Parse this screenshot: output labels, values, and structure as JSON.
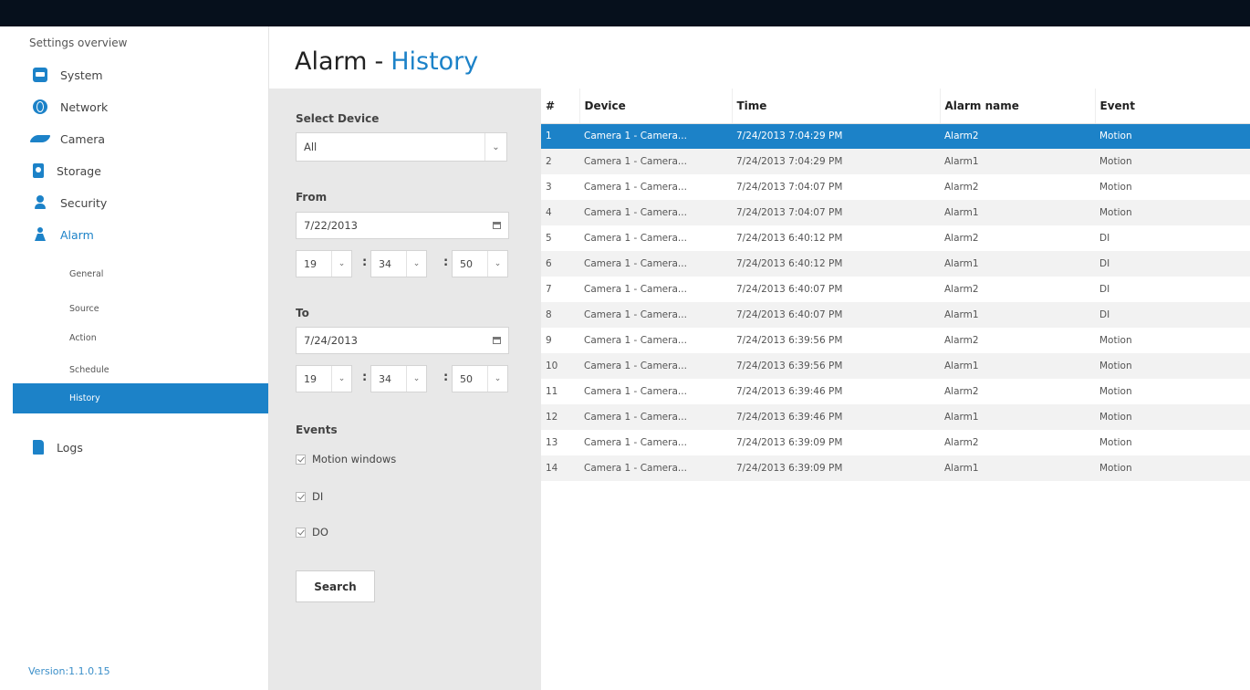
{
  "sidebar": {
    "title": "Settings overview",
    "items": [
      {
        "label": "System",
        "icon": "system-icon"
      },
      {
        "label": "Network",
        "icon": "globe-icon"
      },
      {
        "label": "Camera",
        "icon": "camera-icon"
      },
      {
        "label": "Storage",
        "icon": "storage-icon"
      },
      {
        "label": "Security",
        "icon": "user-icon"
      },
      {
        "label": "Alarm",
        "icon": "alarm-icon"
      },
      {
        "label": "Logs",
        "icon": "logs-icon"
      }
    ],
    "alarm_sub": [
      "General",
      "Source",
      "Action",
      "Schedule",
      "History"
    ],
    "selected_sub": "History",
    "version": "Version:1.1.0.15"
  },
  "header": {
    "title_main": "Alarm",
    "title_sep": "-",
    "title_sub": "History"
  },
  "filter": {
    "device_label": "Select Device",
    "device_value": "All",
    "from_label": "From",
    "from_date": "7/22/2013",
    "from_time": {
      "hour": "19",
      "minute": "34",
      "second": "50"
    },
    "to_label": "To",
    "to_date": "7/24/2013",
    "to_time": {
      "hour": "19",
      "minute": "34",
      "second": "50"
    },
    "events_label": "Events",
    "events": [
      {
        "label": "Motion windows",
        "checked": true
      },
      {
        "label": "DI",
        "checked": true
      },
      {
        "label": "DO",
        "checked": true
      }
    ],
    "search_label": "Search",
    "arrow_glyph": "⌄",
    "colon": ":"
  },
  "table": {
    "headers": [
      "#",
      "Device",
      "Time",
      "Alarm name",
      "Event"
    ],
    "selected_row": 0,
    "rows": [
      [
        "1",
        "Camera 1 - Camera...",
        "7/24/2013 7:04:29 PM",
        "Alarm2",
        "Motion"
      ],
      [
        "2",
        "Camera 1 - Camera...",
        "7/24/2013 7:04:29 PM",
        "Alarm1",
        "Motion"
      ],
      [
        "3",
        "Camera 1 - Camera...",
        "7/24/2013 7:04:07 PM",
        "Alarm2",
        "Motion"
      ],
      [
        "4",
        "Camera 1 - Camera...",
        "7/24/2013 7:04:07 PM",
        "Alarm1",
        "Motion"
      ],
      [
        "5",
        "Camera 1 - Camera...",
        "7/24/2013 6:40:12 PM",
        "Alarm2",
        "DI"
      ],
      [
        "6",
        "Camera 1 - Camera...",
        "7/24/2013 6:40:12 PM",
        "Alarm1",
        "DI"
      ],
      [
        "7",
        "Camera 1 - Camera...",
        "7/24/2013 6:40:07 PM",
        "Alarm2",
        "DI"
      ],
      [
        "8",
        "Camera 1 - Camera...",
        "7/24/2013 6:40:07 PM",
        "Alarm1",
        "DI"
      ],
      [
        "9",
        "Camera 1 - Camera...",
        "7/24/2013 6:39:56 PM",
        "Alarm2",
        "Motion"
      ],
      [
        "10",
        "Camera 1 - Camera...",
        "7/24/2013 6:39:56 PM",
        "Alarm1",
        "Motion"
      ],
      [
        "11",
        "Camera 1 - Camera...",
        "7/24/2013 6:39:46 PM",
        "Alarm2",
        "Motion"
      ],
      [
        "12",
        "Camera 1 - Camera...",
        "7/24/2013 6:39:46 PM",
        "Alarm1",
        "Motion"
      ],
      [
        "13",
        "Camera 1 - Camera...",
        "7/24/2013 6:39:09 PM",
        "Alarm2",
        "Motion"
      ],
      [
        "14",
        "Camera 1 - Camera...",
        "7/24/2013 6:39:09 PM",
        "Alarm1",
        "Motion"
      ]
    ]
  },
  "colors": {
    "accent": "#1c82c8",
    "topbar": "#06101c",
    "panel": "#e8e8e8",
    "row_alt": "#f2f2f2"
  }
}
